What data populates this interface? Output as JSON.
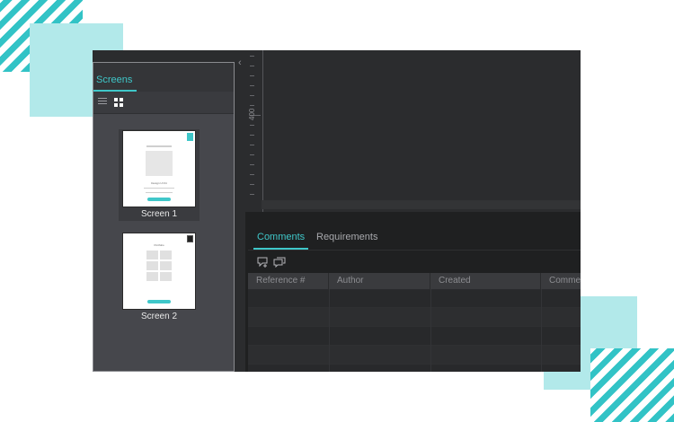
{
  "left_panel": {
    "tab_label": "Screens",
    "screens": [
      {
        "label": "Screen 1",
        "mock_heading": "Design UI Kit"
      },
      {
        "label": "Screen 2",
        "mock_heading": "Portfolio"
      }
    ]
  },
  "canvas": {
    "ruler_label": "400"
  },
  "bottom_panel": {
    "tabs": [
      {
        "label": "Comments"
      },
      {
        "label": "Requirements"
      }
    ],
    "table_headers": [
      "Reference #",
      "Author",
      "Created",
      "Comment"
    ]
  },
  "colors": {
    "accent": "#3fc7c9",
    "panel_bg": "#46474c",
    "app_bg": "#2b2c2e",
    "decor_teal_light": "#b2e9ea",
    "decor_teal_stripe": "#32c3c6"
  },
  "icons": [
    "list-view-icon",
    "grid-view-icon",
    "page-badge-icon",
    "layout-badge-icon",
    "collapse-arrow-icon",
    "add-comment-icon",
    "comments-icon"
  ]
}
